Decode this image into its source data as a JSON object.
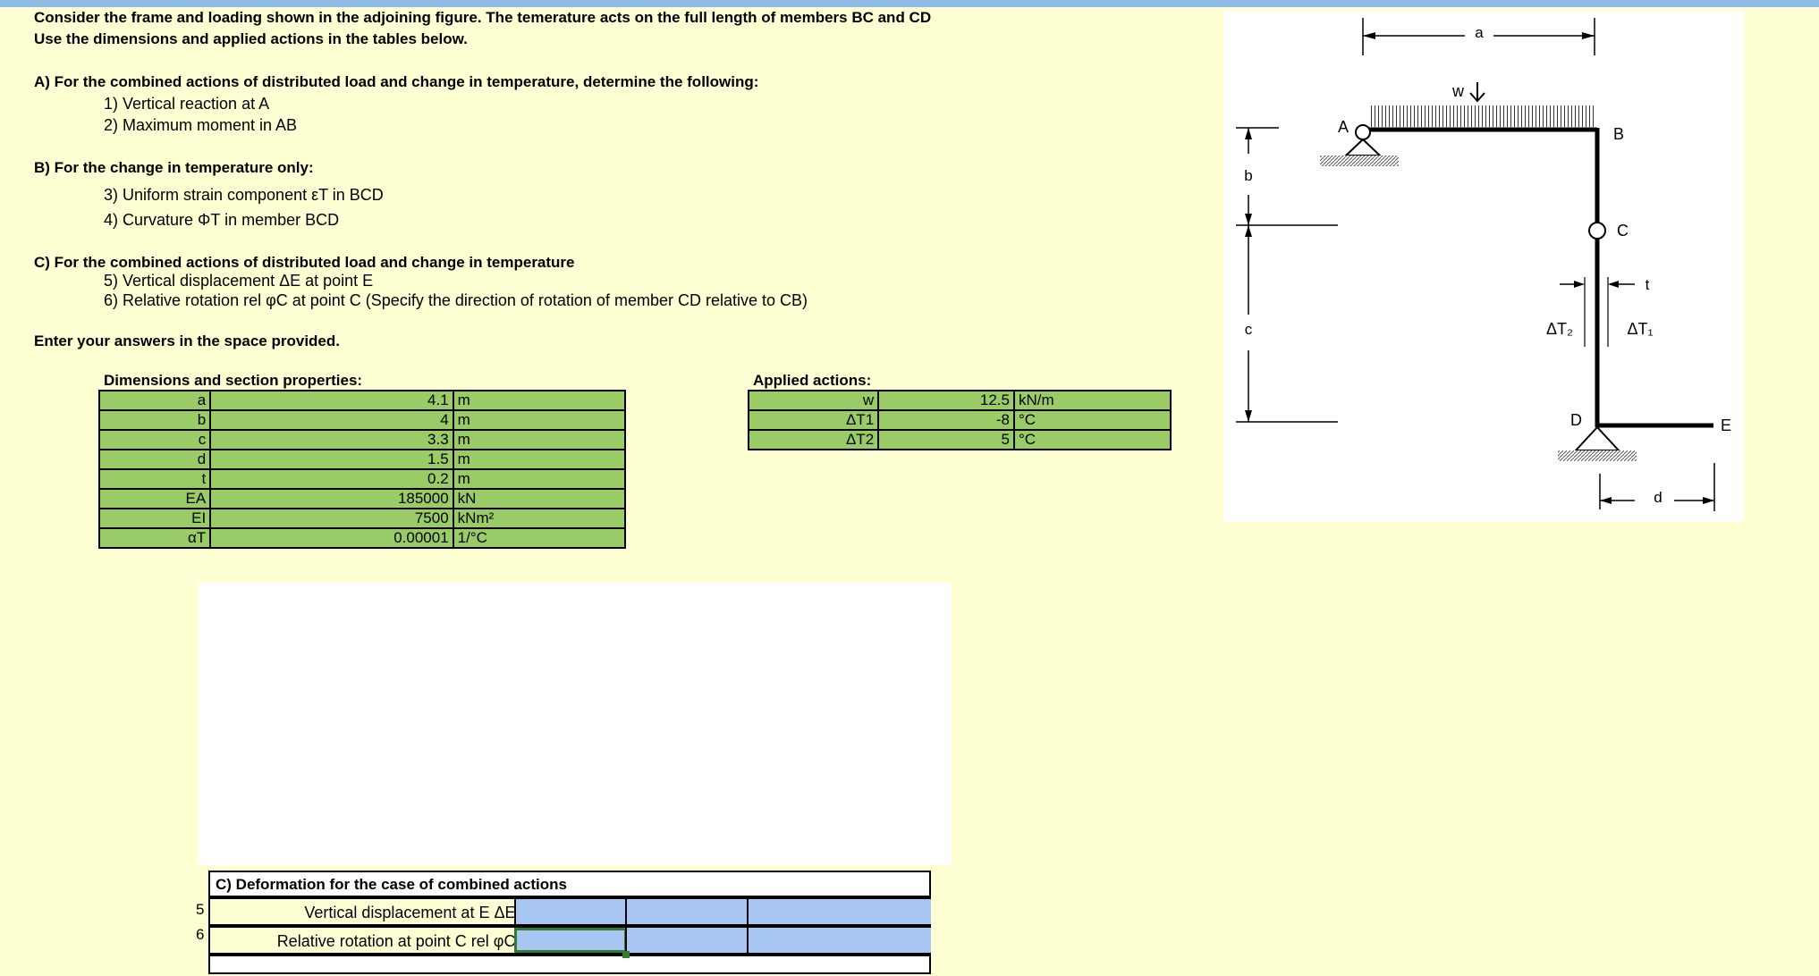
{
  "intro": {
    "line1": "Consider the frame and loading shown in the adjoining figure. The temerature acts on the full length of members BC and CD",
    "line2": "Use the dimensions and applied actions in the tables below."
  },
  "partA": {
    "heading": "A) For the combined actions of distributed load and change in temperature, determine the following:",
    "q1": "1) Vertical reaction at A",
    "q2": "2) Maximum moment in AB"
  },
  "partB": {
    "heading": "B) For the change in temperature only:",
    "q3": "3) Uniform strain component εT in BCD",
    "q4": "4) Curvature ΦT in member BCD"
  },
  "partC": {
    "heading": "C) For the combined actions of distributed load and change in temperature",
    "q5": "5) Vertical displacement ΔE at point E",
    "q6": "6) Relative rotation rel φC at point C (Specify the direction of rotation of member CD relative to CB)"
  },
  "enter_answers": "Enter your answers in the space provided.",
  "dimensions": {
    "title": "Dimensions  and section properties:",
    "rows": [
      {
        "name": "a",
        "value": "4.1",
        "unit": "m"
      },
      {
        "name": "b",
        "value": "4",
        "unit": "m"
      },
      {
        "name": "c",
        "value": "3.3",
        "unit": "m"
      },
      {
        "name": "d",
        "value": "1.5",
        "unit": "m"
      },
      {
        "name": "t",
        "value": "0.2",
        "unit": "m"
      },
      {
        "name": "EA",
        "value": "185000",
        "unit": "kN"
      },
      {
        "name": "EI",
        "value": "7500",
        "unit": "kNm²"
      },
      {
        "name": "αT",
        "value": "0.00001",
        "unit": "1/°C"
      }
    ]
  },
  "actions": {
    "title": "Applied actions:",
    "rows": [
      {
        "name": "w",
        "value": "12.5",
        "unit": "kN/m"
      },
      {
        "name": "ΔT1",
        "value": "-8",
        "unit": "°C"
      },
      {
        "name": "ΔT2",
        "value": "5",
        "unit": "°C"
      }
    ]
  },
  "answer_section": {
    "heading": "C) Deformation for the case of combined actions",
    "row5_num": "5",
    "row5_label": "Vertical displacement at E ΔE=",
    "row6_num": "6",
    "row6_label": "Relative rotation at point C rel φC="
  },
  "figure": {
    "label_a": "a",
    "label_b": "b",
    "label_c": "c",
    "label_d": "d",
    "label_t": "t",
    "label_w": "w",
    "node_A": "A",
    "node_B": "B",
    "node_C": "C",
    "node_D": "D",
    "node_E": "E",
    "label_dT1": "ΔT₁",
    "label_dT2": "ΔT₂"
  },
  "colors": {
    "sheet_background": "#ffffd4",
    "table_green": "#99cc66",
    "answer_blue": "#a7c7f2",
    "top_bar": "#8fbde8"
  }
}
